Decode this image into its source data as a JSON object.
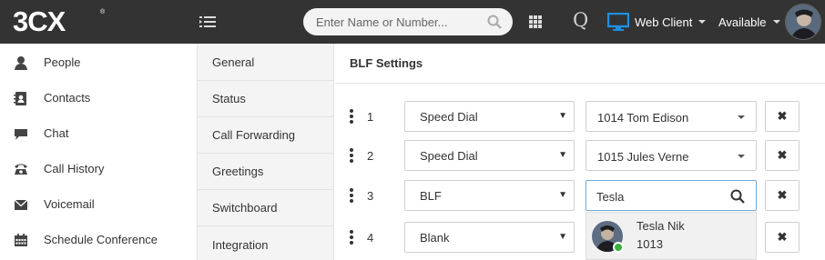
{
  "header": {
    "logo_text": "3CX",
    "search_placeholder": "Enter Name or Number...",
    "q_label": "Q",
    "web_client_label": "Web Client",
    "status_label": "Available"
  },
  "sidebar": {
    "items": [
      {
        "label": "People",
        "icon": "person-icon"
      },
      {
        "label": "Contacts",
        "icon": "contacts-icon"
      },
      {
        "label": "Chat",
        "icon": "chat-icon"
      },
      {
        "label": "Call History",
        "icon": "phone-icon"
      },
      {
        "label": "Voicemail",
        "icon": "envelope-icon"
      },
      {
        "label": "Schedule Conference",
        "icon": "calendar-icon"
      }
    ]
  },
  "settings_nav": {
    "items": [
      "General",
      "Status",
      "Call Forwarding",
      "Greetings",
      "Switchboard",
      "Integration"
    ]
  },
  "main": {
    "title": "BLF Settings",
    "rows": [
      {
        "num": "1",
        "type": "Speed Dial",
        "value": "1014 Tom Edison"
      },
      {
        "num": "2",
        "type": "Speed Dial",
        "value": "1015 Jules Verne"
      },
      {
        "num": "3",
        "type": "BLF",
        "value": "Tesla"
      },
      {
        "num": "4",
        "type": "Blank",
        "value": ""
      }
    ],
    "remove_glyph": "✖",
    "select_arrow": "▼",
    "dropdown": {
      "name": "Tesla Nik",
      "ext": "1013",
      "presence": "available",
      "presence_color": "#3ab03e"
    }
  }
}
